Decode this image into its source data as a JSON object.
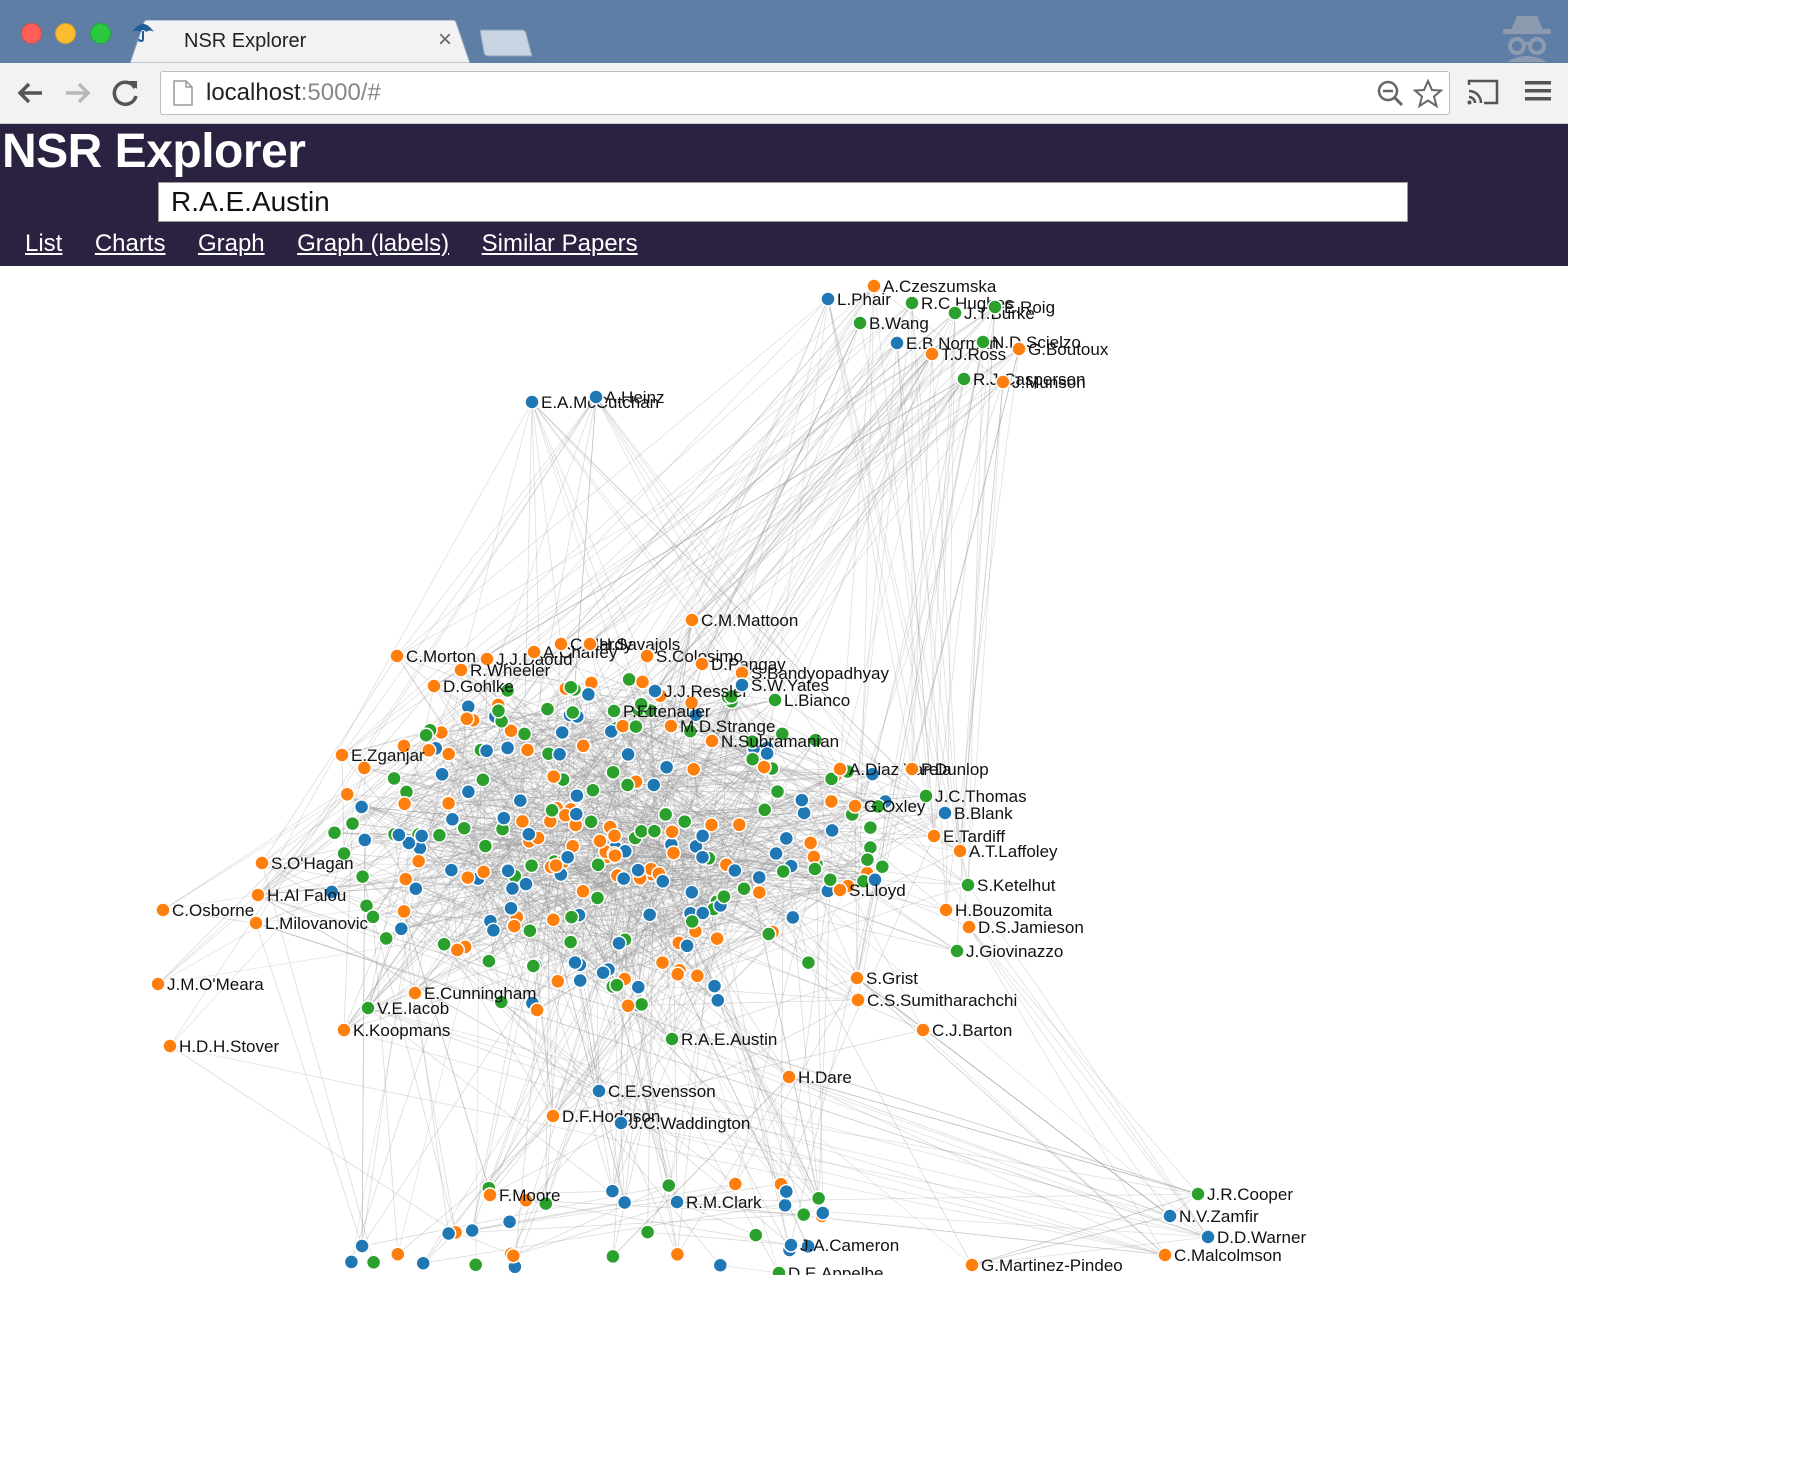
{
  "browser": {
    "tab_title": "NSR Explorer",
    "tab_close": "×",
    "url_host": "localhost",
    "url_rest": ":5000/#"
  },
  "app": {
    "title": "NSR Explorer",
    "search_value": "R.A.E.Austin",
    "nav": [
      "List",
      "Charts",
      "Graph",
      "Graph (labels)",
      "Similar Papers"
    ]
  },
  "colors": {
    "header_bg": "#2b2140",
    "orange": "#ff7f0e",
    "blue": "#1f77b4",
    "green": "#2ca02c",
    "edge": "#999999"
  },
  "graph": {
    "nodes": [
      {
        "label": "A.Czeszumska",
        "color": "orange"
      },
      {
        "label": "L.Phair",
        "color": "blue"
      },
      {
        "label": "R.C.Hughes",
        "color": "green"
      },
      {
        "label": "J.T.Burke",
        "color": "green"
      },
      {
        "label": "E.Roig",
        "color": "green"
      },
      {
        "label": "B.Wang",
        "color": "green"
      },
      {
        "label": "E.B.Norman",
        "color": "blue"
      },
      {
        "label": "N.D.Scielzo",
        "color": "green"
      },
      {
        "label": "G.Boutoux",
        "color": "orange"
      },
      {
        "label": "T.J.Ross",
        "color": "orange"
      },
      {
        "label": "R.J.Casperson",
        "color": "green"
      },
      {
        "label": "J.Munson",
        "color": "orange"
      },
      {
        "label": "E.A.McCutchan",
        "color": "blue"
      },
      {
        "label": "A.Heinz",
        "color": "blue"
      },
      {
        "label": "C.M.Mattoon",
        "color": "orange"
      },
      {
        "label": "C.Morton",
        "color": "orange"
      },
      {
        "label": "J.J.Daoud",
        "color": "orange"
      },
      {
        "label": "R.Wheeler",
        "color": "orange"
      },
      {
        "label": "D.Gohlke",
        "color": "orange"
      },
      {
        "label": "A.Chaffey",
        "color": "orange"
      },
      {
        "label": "C.Hardy",
        "color": "orange"
      },
      {
        "label": "H.Savajols",
        "color": "orange"
      },
      {
        "label": "S.Colosimo",
        "color": "orange"
      },
      {
        "label": "D.Pangay",
        "color": "orange"
      },
      {
        "label": "S.Bandyopadhyay",
        "color": "orange"
      },
      {
        "label": "J.J.Ressler",
        "color": "blue"
      },
      {
        "label": "S.W.Yates",
        "color": "blue"
      },
      {
        "label": "L.Bianco",
        "color": "green"
      },
      {
        "label": "P.Ettenauer",
        "color": "green"
      },
      {
        "label": "M.D.Strange",
        "color": "orange"
      },
      {
        "label": "N.Subramanian",
        "color": "orange"
      },
      {
        "label": "E.Zganjar",
        "color": "orange"
      },
      {
        "label": "A.Diaz Varela",
        "color": "orange"
      },
      {
        "label": "P.Dunlop",
        "color": "orange"
      },
      {
        "label": "J.C.Thomas",
        "color": "green"
      },
      {
        "label": "B.Blank",
        "color": "blue"
      },
      {
        "label": "G.Oxley",
        "color": "orange"
      },
      {
        "label": "E.Tardiff",
        "color": "orange"
      },
      {
        "label": "A.T.Laffoley",
        "color": "orange"
      },
      {
        "label": "S.O'Hagan",
        "color": "orange"
      },
      {
        "label": "H.Al Falou",
        "color": "orange"
      },
      {
        "label": "S.Ketelhut",
        "color": "green"
      },
      {
        "label": "C.Osborne",
        "color": "orange"
      },
      {
        "label": "L.Milovanovic",
        "color": "orange"
      },
      {
        "label": "S.Lloyd",
        "color": "orange"
      },
      {
        "label": "H.Bouzomita",
        "color": "orange"
      },
      {
        "label": "D.S.Jamieson",
        "color": "orange"
      },
      {
        "label": "J.Giovinazzo",
        "color": "green"
      },
      {
        "label": "J.M.O'Meara",
        "color": "orange"
      },
      {
        "label": "S.Grist",
        "color": "orange"
      },
      {
        "label": "C.S.Sumitharachchi",
        "color": "orange"
      },
      {
        "label": "E.Cunningham",
        "color": "orange"
      },
      {
        "label": "V.E.Iacob",
        "color": "green"
      },
      {
        "label": "K.Koopmans",
        "color": "orange"
      },
      {
        "label": "H.D.H.Stover",
        "color": "orange"
      },
      {
        "label": "C.J.Barton",
        "color": "orange"
      },
      {
        "label": "R.A.E.Austin",
        "color": "green"
      },
      {
        "label": "C.E.Svensson",
        "color": "blue"
      },
      {
        "label": "D.F.Hodgson",
        "color": "orange"
      },
      {
        "label": "J.C.Waddington",
        "color": "blue"
      },
      {
        "label": "H.Dare",
        "color": "orange"
      },
      {
        "label": "J.R.Cooper",
        "color": "green"
      },
      {
        "label": "N.V.Zamfir",
        "color": "blue"
      },
      {
        "label": "D.D.Warner",
        "color": "blue"
      },
      {
        "label": "C.Malcolmson",
        "color": "orange"
      },
      {
        "label": "J.A.Cameron",
        "color": "blue"
      },
      {
        "label": "G.Martinez-Pindeo",
        "color": "orange"
      },
      {
        "label": "R.M.Clark",
        "color": "blue"
      },
      {
        "label": "F.Moore",
        "color": "orange"
      },
      {
        "label": "D.E.Appelbe",
        "color": "green"
      }
    ]
  }
}
